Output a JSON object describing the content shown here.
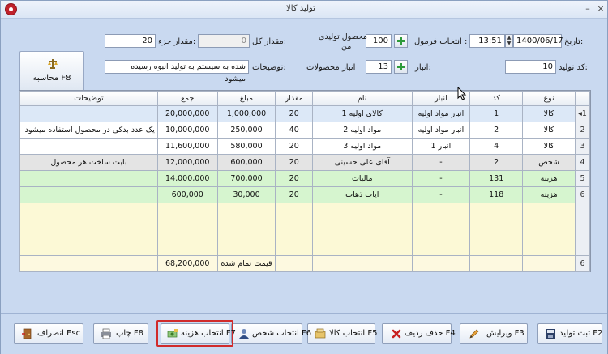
{
  "window": {
    "title": "تولید کالا",
    "minimize": "–",
    "close": "×"
  },
  "form": {
    "date_label": "تاریخ:",
    "date_value": "1400/06/17",
    "time_value": "13:51",
    "formula_label": "انتخاب فرمول :",
    "produced_label_1": "محصول تولیدی",
    "produced_label_2": "من",
    "produced_value": "100",
    "total_qty_label": "مقدار کل:",
    "total_qty_value": "0",
    "part_qty_label": "مقدار جزء:",
    "part_qty_value": "20",
    "prod_code_label": "کد تولید:",
    "prod_code_value": "10",
    "warehouse_label": "انبار:",
    "warehouse_value": "13",
    "products_warehouse_label": "انبار محصولات",
    "desc_label": "توضیحات:",
    "desc_value": "شده به سیستم به تولید انبوه رسیده میشود",
    "calc_button": "محاسبه F8"
  },
  "grid": {
    "headers": [
      "نوع",
      "کد",
      "انبار",
      "نام",
      "مقدار",
      "مبلغ",
      "جمع",
      "توضیحات"
    ],
    "rows": [
      {
        "num": "1",
        "type": "کالا",
        "code": "1",
        "warehouse": "انبار مواد اولیه",
        "name": "کالای اولیه 1",
        "qty": "20",
        "price": "1,000,000",
        "total": "20,000,000",
        "desc": ""
      },
      {
        "num": "2",
        "type": "کالا",
        "code": "2",
        "warehouse": "انبار مواد اولیه",
        "name": "مواد اولیه 2",
        "qty": "40",
        "price": "250,000",
        "total": "10,000,000",
        "desc": "یک عدد بدکی در محصول استفاده میشود"
      },
      {
        "num": "3",
        "type": "کالا",
        "code": "4",
        "warehouse": "انبار 1",
        "name": "مواد اولیه 3",
        "qty": "20",
        "price": "580,000",
        "total": "11,600,000",
        "desc": ""
      },
      {
        "num": "4",
        "type": "شخص",
        "code": "2",
        "warehouse": "-",
        "name": "آقای علی حسینی",
        "qty": "20",
        "price": "600,000",
        "total": "12,000,000",
        "desc": "بابت ساخت هر محصول"
      },
      {
        "num": "5",
        "type": "هزینه",
        "code": "131",
        "warehouse": "-",
        "name": "مالیات",
        "qty": "20",
        "price": "700,000",
        "total": "14,000,000",
        "desc": ""
      },
      {
        "num": "6",
        "type": "هزینه",
        "code": "118",
        "warehouse": "-",
        "name": "ایاب ذهاب",
        "qty": "20",
        "price": "30,000",
        "total": "600,000",
        "desc": ""
      }
    ],
    "footer": {
      "count": "6",
      "label": "قیمت تمام شده",
      "sum": "68,200,000"
    }
  },
  "toolbar": {
    "save": "ثبت تولید F2",
    "edit": "ویرایش F3",
    "delete_row": "حذف ردیف F4",
    "select_goods": "انتخاب کالا F5",
    "select_person": "انتخاب شخص F6",
    "select_cost": "انتخاب هزینه F7",
    "print": "چاپ F8",
    "cancel": "انصراف Esc"
  }
}
